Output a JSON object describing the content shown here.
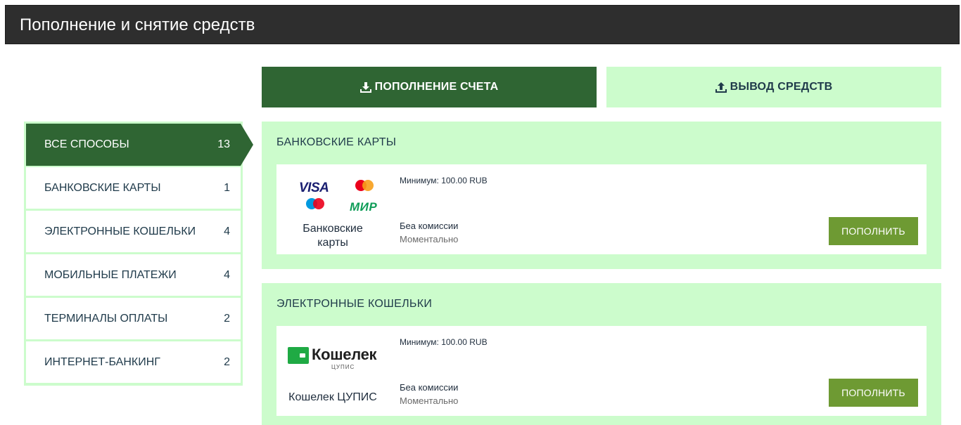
{
  "header": {
    "title": "Пополнение и снятие средств"
  },
  "tabs": [
    {
      "label": "ПОПОЛНЕНИЕ СЧЕТА",
      "icon": "download-icon"
    },
    {
      "label": "ВЫВОД СРЕДСТВ",
      "icon": "upload-icon"
    }
  ],
  "sidebar": {
    "items": [
      {
        "label": "ВСЕ СПОСОБЫ",
        "count": "13"
      },
      {
        "label": "БАНКОВСКИЕ КАРТЫ",
        "count": "1"
      },
      {
        "label": "ЭЛЕКТРОННЫЕ КОШЕЛЬКИ",
        "count": "4"
      },
      {
        "label": "МОБИЛЬНЫЕ ПЛАТЕЖИ",
        "count": "4"
      },
      {
        "label": "ТЕРМИНАЛЫ ОПЛАТЫ",
        "count": "2"
      },
      {
        "label": "ИНТЕРНЕТ-БАНКИНГ",
        "count": "2"
      }
    ]
  },
  "sections": [
    {
      "title": "БАНКОВСКИЕ КАРТЫ",
      "card": {
        "logos": {
          "visa": "VISA",
          "mir": "МИР"
        },
        "name_line1": "Банковские",
        "name_line2": "карты",
        "minimum": "Минимум: 100.00 RUB",
        "fee": "Беа комиссии",
        "speed": "Моментально",
        "button": "ПОПОЛНИТЬ"
      }
    },
    {
      "title": "ЭЛЕКТРОННЫЕ КОШЕЛЬКИ",
      "card": {
        "logos": {
          "brand": "Кошелек",
          "sub": "ЦУПИС"
        },
        "name_line1": "Кошелек ЦУПИС",
        "minimum": "Минимум: 100.00 RUB",
        "fee": "Беа комиссии",
        "speed": "Моментально",
        "button": "ПОПОЛНИТЬ"
      }
    }
  ],
  "colors": {
    "header_bg": "#2e2e2e",
    "dark_green": "#2f6533",
    "light_green": "#ccfccc",
    "button_green": "#6e9a33"
  }
}
